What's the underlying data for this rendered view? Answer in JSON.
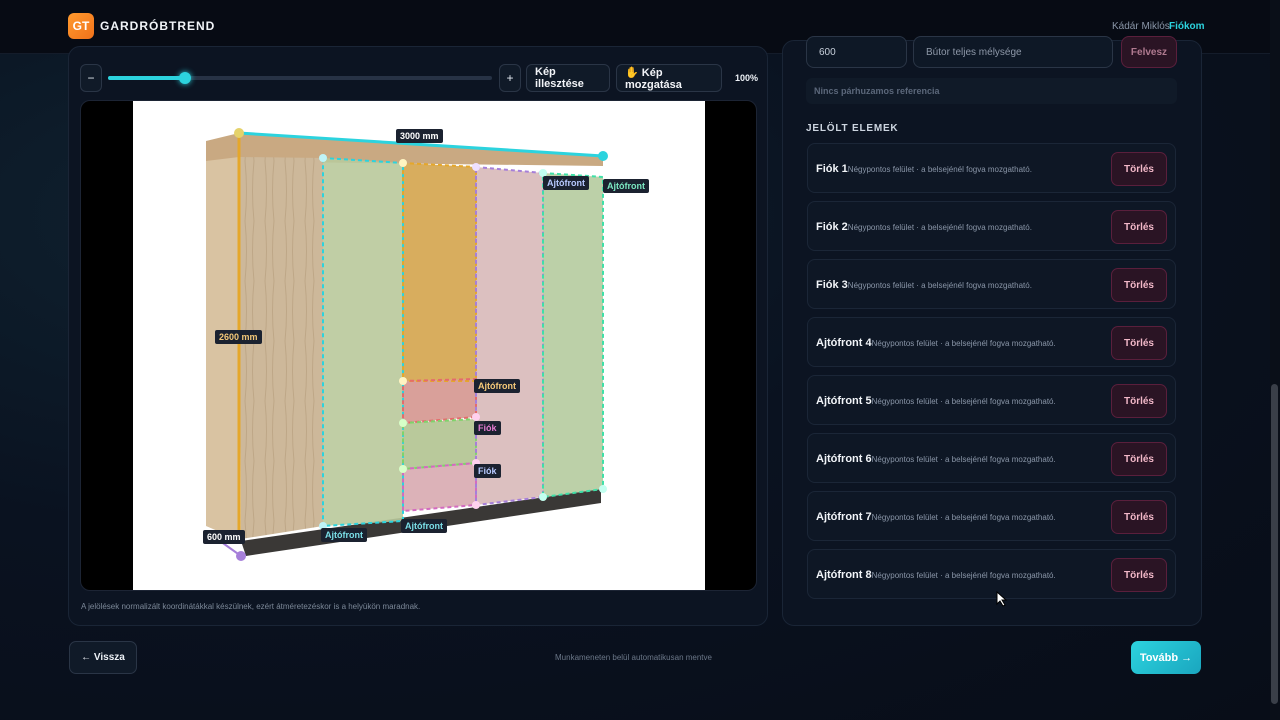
{
  "header": {
    "logo_badge": "GT",
    "brand": "GARDRÓBTREND",
    "user": "Kádár Miklós",
    "account_link": "Fiókom"
  },
  "toolbar": {
    "zoom_out": "−",
    "zoom_in": "+",
    "fit_image": "Kép illesztése",
    "move_image": "✋ Kép mozgatása",
    "zoom_pct": "100%",
    "zoom_level": 0.2
  },
  "canvas": {
    "note": "A jelölések normalizált koordinátákkal készülnek, ezért átméretezéskor is a helyükön maradnak.",
    "dims": {
      "width": "3000 mm",
      "height": "2600 mm",
      "depth": "600 mm"
    },
    "labels": [
      "Ajtófront",
      "Ajtófront",
      "Ajtófront",
      "Fiók",
      "Fiók",
      "Ajtófront",
      "Ajtófront"
    ]
  },
  "right_panel": {
    "input_value": "600",
    "input_placeholder": "Bútor teljes mélysége",
    "add_button": "Felvesz",
    "no_parallel_ref": "Nincs párhuzamos referencia",
    "section_title": "JELÖLT ELEMEK",
    "item_desc": "Négypontos felület · a belsejénél fogva mozgatható.",
    "delete_label": "Törlés",
    "items": [
      {
        "name": "Fiók 1"
      },
      {
        "name": "Fiók 2"
      },
      {
        "name": "Fiók 3"
      },
      {
        "name": "Ajtófront 4"
      },
      {
        "name": "Ajtófront 5"
      },
      {
        "name": "Ajtófront 6"
      },
      {
        "name": "Ajtófront 7"
      },
      {
        "name": "Ajtófront 8"
      }
    ]
  },
  "footer": {
    "back": "← Vissza",
    "autosave": "Munkameneten belül automatikusan mentve",
    "next": "Tovább →"
  }
}
